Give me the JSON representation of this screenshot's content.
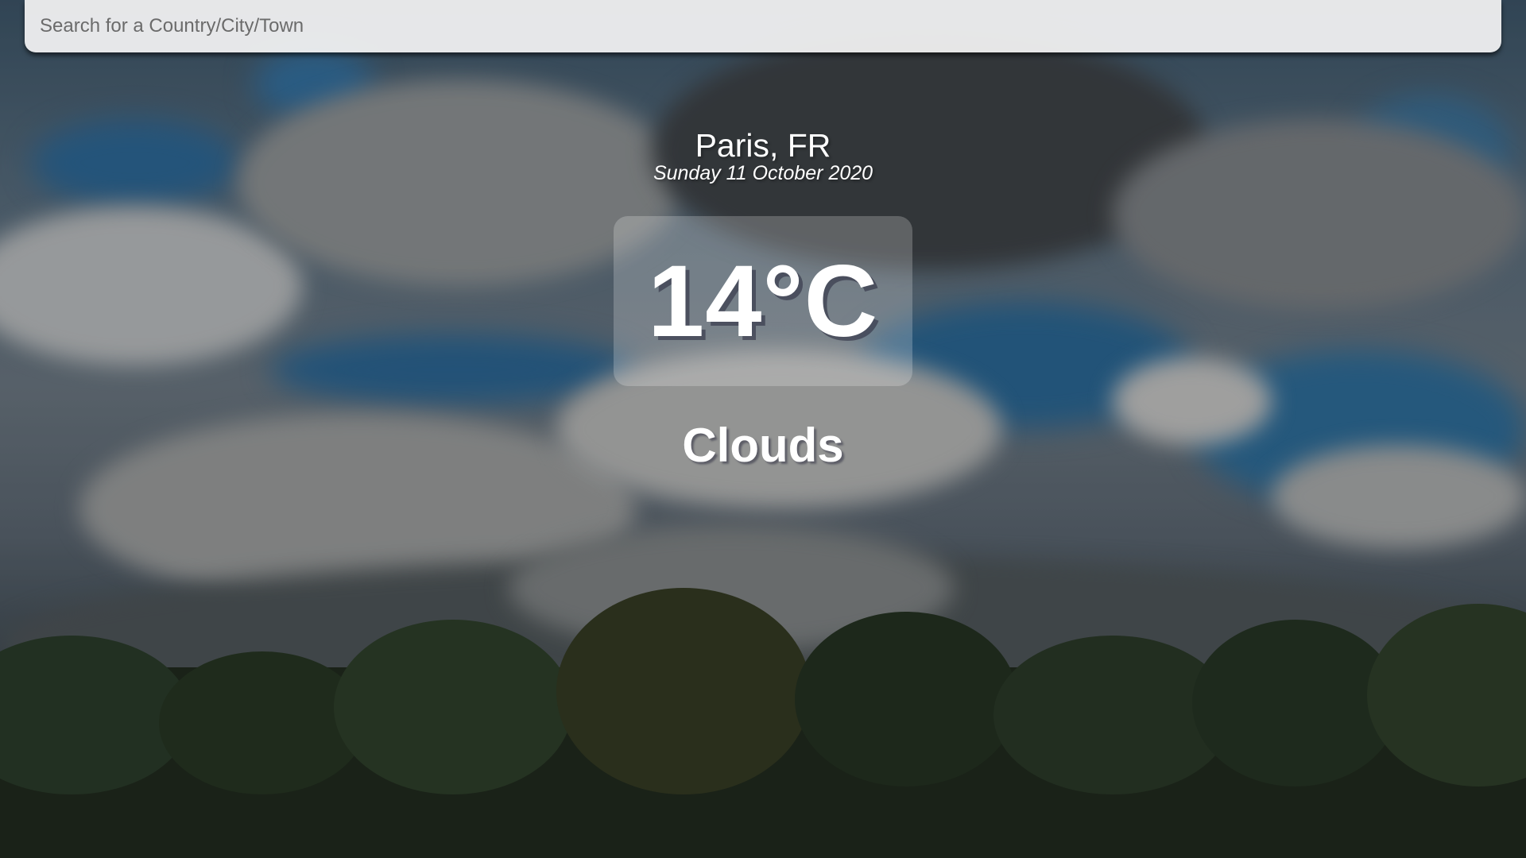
{
  "search": {
    "placeholder": "Search for a Country/City/Town",
    "value": ""
  },
  "weather": {
    "location": "Paris, FR",
    "date": "Sunday 11 October 2020",
    "temperature": "14°C",
    "condition": "Clouds"
  },
  "background": {
    "scene": "cloudy sky over treeline"
  },
  "colors": {
    "text": "#ffffff",
    "search_bg": "#f5f5f5",
    "sky_blue": "#2f6a9a"
  }
}
